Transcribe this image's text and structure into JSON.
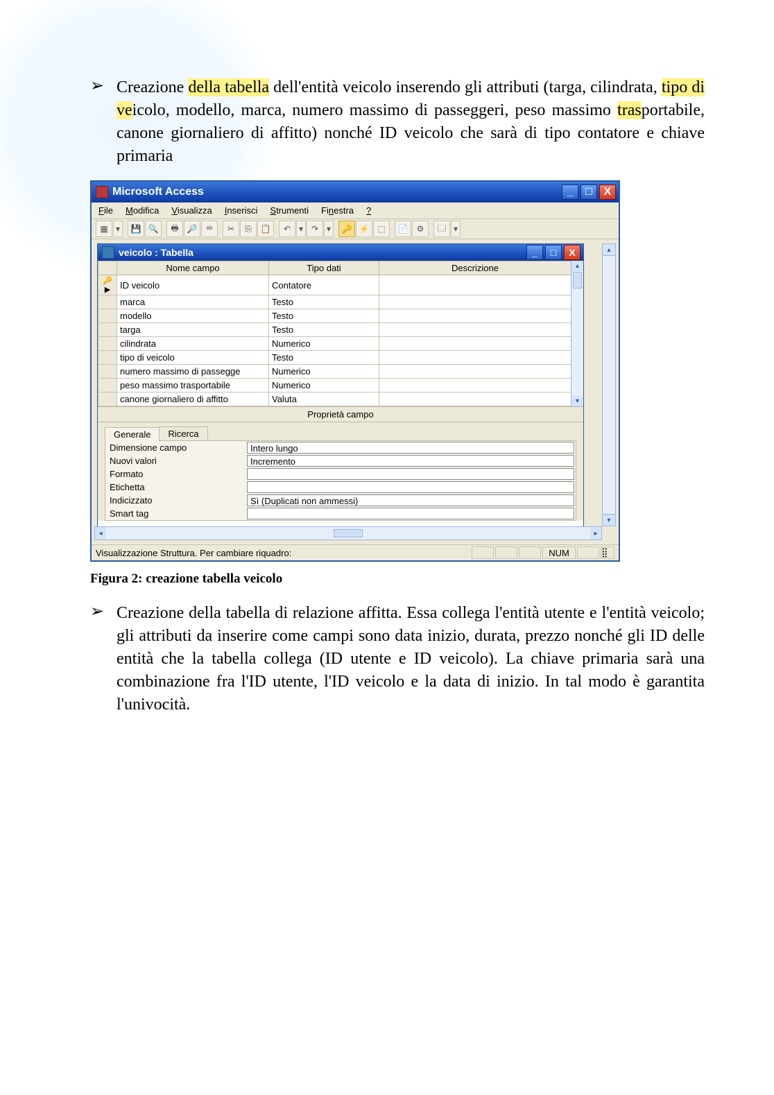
{
  "bullets": {
    "b1": "Creazione della tabella dell'entità veicolo inserendo gli attributi (targa, cilindrata, tipo di veicolo, modello, marca, numero massimo di passeggeri, peso massimo trasportabile, canone giornaliero di affitto) nonché ID veicolo che sarà di tipo contatore e chiave primaria",
    "b2": "Creazione della tabella di relazione affitta. Essa collega l'entità utente e l'entità veicolo; gli attributi da inserire come campi sono data inizio, durata, prezzo nonché gli ID delle entità che la tabella collega (ID utente e ID veicolo). La chiave primaria sarà una combinazione fra l'ID utente, l'ID veicolo e la data di inizio. In tal modo è garantita l'univocità."
  },
  "figcaption": "Figura 2: creazione tabella veicolo",
  "app": {
    "title": "Microsoft Access",
    "menus": {
      "file": "File",
      "modifica": "Modifica",
      "visualizza": "Visualizza",
      "inserisci": "Inserisci",
      "strumenti": "Strumenti",
      "finestra": "Finestra",
      "help": "?"
    },
    "childTitle": "veicolo : Tabella",
    "headers": {
      "name": "Nome campo",
      "type": "Tipo dati",
      "desc": "Descrizione"
    },
    "rows": [
      {
        "key": true,
        "name": "ID veicolo",
        "type": "Contatore"
      },
      {
        "key": false,
        "name": "marca",
        "type": "Testo"
      },
      {
        "key": false,
        "name": "modello",
        "type": "Testo"
      },
      {
        "key": false,
        "name": "targa",
        "type": "Testo"
      },
      {
        "key": false,
        "name": "cilindrata",
        "type": "Numerico"
      },
      {
        "key": false,
        "name": "tipo di veicolo",
        "type": "Testo"
      },
      {
        "key": false,
        "name": "numero massimo di passegge",
        "type": "Numerico"
      },
      {
        "key": false,
        "name": "peso massimo trasportabile",
        "type": "Numerico"
      },
      {
        "key": false,
        "name": "canone giornaliero di affitto",
        "type": "Valuta"
      }
    ],
    "propCaption": "Proprietà campo",
    "tabs": {
      "generale": "Generale",
      "ricerca": "Ricerca"
    },
    "props": [
      {
        "label": "Dimensione campo",
        "value": "Intero lungo"
      },
      {
        "label": "Nuovi valori",
        "value": "Incremento"
      },
      {
        "label": "Formato",
        "value": ""
      },
      {
        "label": "Etichetta",
        "value": ""
      },
      {
        "label": "Indicizzato",
        "value": "Sì (Duplicati non ammessi)"
      },
      {
        "label": "Smart tag",
        "value": ""
      }
    ],
    "status": "Visualizzazione Struttura. Per cambiare riquadro:",
    "num": "NUM"
  }
}
